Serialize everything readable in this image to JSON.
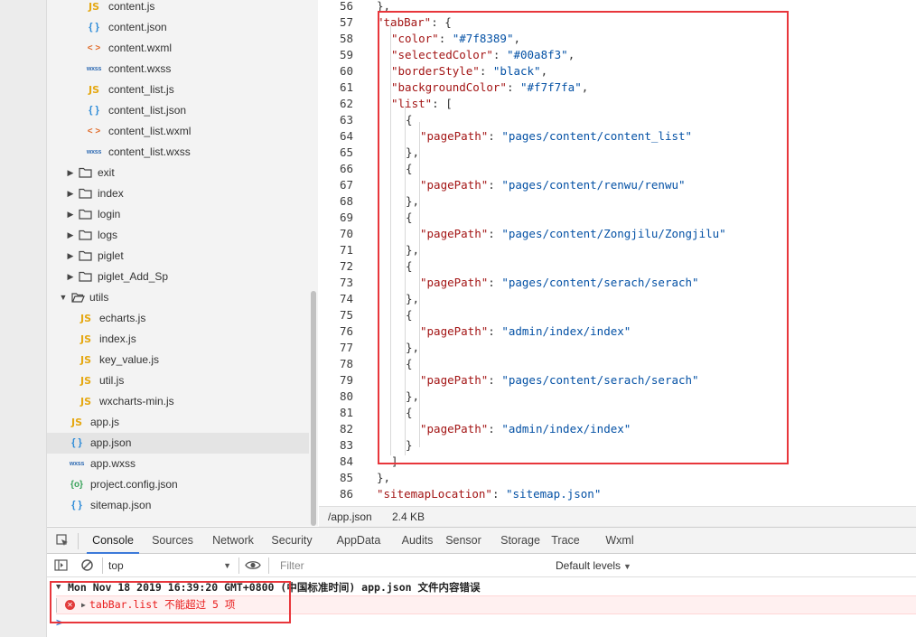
{
  "file_tree": {
    "items": [
      {
        "kind": "js",
        "icon": "JS",
        "label": "content.js"
      },
      {
        "kind": "json",
        "icon": "{ }",
        "label": "content.json"
      },
      {
        "kind": "wxml",
        "icon": "< >",
        "label": "content.wxml"
      },
      {
        "kind": "wxss",
        "icon": "wxss",
        "label": "content.wxss"
      },
      {
        "kind": "js",
        "icon": "JS",
        "label": "content_list.js"
      },
      {
        "kind": "json",
        "icon": "{ }",
        "label": "content_list.json"
      },
      {
        "kind": "wxml",
        "icon": "< >",
        "label": "content_list.wxml"
      },
      {
        "kind": "wxss",
        "icon": "wxss",
        "label": "content_list.wxss"
      },
      {
        "kind": "folder",
        "icon": "folder",
        "label": "exit"
      },
      {
        "kind": "folder",
        "icon": "folder",
        "label": "index"
      },
      {
        "kind": "folder",
        "icon": "folder",
        "label": "login"
      },
      {
        "kind": "folder",
        "icon": "folder",
        "label": "logs"
      },
      {
        "kind": "folder",
        "icon": "folder",
        "label": "piglet"
      },
      {
        "kind": "folder",
        "icon": "folder",
        "label": "piglet_Add_Sp"
      },
      {
        "kind": "folder-open",
        "icon": "folder-open",
        "label": "utils"
      },
      {
        "kind": "js",
        "icon": "JS",
        "label": "echarts.js"
      },
      {
        "kind": "js",
        "icon": "JS",
        "label": "index.js"
      },
      {
        "kind": "js",
        "icon": "JS",
        "label": "key_value.js"
      },
      {
        "kind": "js",
        "icon": "JS",
        "label": "util.js"
      },
      {
        "kind": "js",
        "icon": "JS",
        "label": "wxcharts-min.js"
      },
      {
        "kind": "js",
        "icon": "JS",
        "label": "app.js"
      },
      {
        "kind": "json",
        "icon": "{ }",
        "label": "app.json",
        "selected": true
      },
      {
        "kind": "wxss",
        "icon": "wxss",
        "label": "app.wxss"
      },
      {
        "kind": "config",
        "icon": "{o}",
        "label": "project.config.json"
      },
      {
        "kind": "json",
        "icon": "{ }",
        "label": "sitemap.json"
      }
    ]
  },
  "editor": {
    "lines": [
      {
        "n": "56",
        "t": [
          [
            "p",
            "},"
          ]
        ]
      },
      {
        "n": "57",
        "t": [
          [
            "k",
            "\"tabBar\""
          ],
          [
            "p",
            ": {"
          ]
        ]
      },
      {
        "n": "58",
        "t": [
          [
            "k",
            "\"color\""
          ],
          [
            "p",
            ": "
          ],
          [
            "s",
            "\"#7f8389\""
          ],
          [
            "p",
            ","
          ]
        ]
      },
      {
        "n": "59",
        "t": [
          [
            "k",
            "\"selectedColor\""
          ],
          [
            "p",
            ": "
          ],
          [
            "s",
            "\"#00a8f3\""
          ],
          [
            "p",
            ","
          ]
        ]
      },
      {
        "n": "60",
        "t": [
          [
            "k",
            "\"borderStyle\""
          ],
          [
            "p",
            ": "
          ],
          [
            "s",
            "\"black\""
          ],
          [
            "p",
            ","
          ]
        ]
      },
      {
        "n": "61",
        "t": [
          [
            "k",
            "\"backgroundColor\""
          ],
          [
            "p",
            ": "
          ],
          [
            "s",
            "\"#f7f7fa\""
          ],
          [
            "p",
            ","
          ]
        ]
      },
      {
        "n": "62",
        "t": [
          [
            "k",
            "\"list\""
          ],
          [
            "p",
            ": ["
          ]
        ]
      },
      {
        "n": "63",
        "t": [
          [
            "p",
            "{"
          ]
        ]
      },
      {
        "n": "64",
        "t": [
          [
            "k",
            "\"pagePath\""
          ],
          [
            "p",
            ": "
          ],
          [
            "s",
            "\"pages/content/content_list\""
          ]
        ]
      },
      {
        "n": "65",
        "t": [
          [
            "p",
            "},"
          ]
        ]
      },
      {
        "n": "66",
        "t": [
          [
            "p",
            "{"
          ]
        ]
      },
      {
        "n": "67",
        "t": [
          [
            "k",
            "\"pagePath\""
          ],
          [
            "p",
            ": "
          ],
          [
            "s",
            "\"pages/content/renwu/renwu\""
          ]
        ]
      },
      {
        "n": "68",
        "t": [
          [
            "p",
            "},"
          ]
        ]
      },
      {
        "n": "69",
        "t": [
          [
            "p",
            "{"
          ]
        ]
      },
      {
        "n": "70",
        "t": [
          [
            "k",
            "\"pagePath\""
          ],
          [
            "p",
            ": "
          ],
          [
            "s",
            "\"pages/content/Zongjilu/Zongjilu\""
          ]
        ]
      },
      {
        "n": "71",
        "t": [
          [
            "p",
            "},"
          ]
        ]
      },
      {
        "n": "72",
        "t": [
          [
            "p",
            "{"
          ]
        ]
      },
      {
        "n": "73",
        "t": [
          [
            "k",
            "\"pagePath\""
          ],
          [
            "p",
            ": "
          ],
          [
            "s",
            "\"pages/content/serach/serach\""
          ]
        ]
      },
      {
        "n": "74",
        "t": [
          [
            "p",
            "},"
          ]
        ]
      },
      {
        "n": "75",
        "t": [
          [
            "p",
            "{"
          ]
        ]
      },
      {
        "n": "76",
        "t": [
          [
            "k",
            "\"pagePath\""
          ],
          [
            "p",
            ": "
          ],
          [
            "s",
            "\"admin/index/index\""
          ]
        ]
      },
      {
        "n": "77",
        "t": [
          [
            "p",
            "},"
          ]
        ]
      },
      {
        "n": "78",
        "t": [
          [
            "p",
            "{"
          ]
        ]
      },
      {
        "n": "79",
        "t": [
          [
            "k",
            "\"pagePath\""
          ],
          [
            "p",
            ": "
          ],
          [
            "s",
            "\"pages/content/serach/serach\""
          ]
        ]
      },
      {
        "n": "80",
        "t": [
          [
            "p",
            "},"
          ]
        ]
      },
      {
        "n": "81",
        "t": [
          [
            "p",
            "{"
          ]
        ]
      },
      {
        "n": "82",
        "t": [
          [
            "k",
            "\"pagePath\""
          ],
          [
            "p",
            ": "
          ],
          [
            "s",
            "\"admin/index/index\""
          ]
        ]
      },
      {
        "n": "83",
        "t": [
          [
            "p",
            "}"
          ]
        ]
      },
      {
        "n": "84",
        "t": [
          [
            "p",
            "]"
          ]
        ]
      },
      {
        "n": "85",
        "t": [
          [
            "p",
            "},"
          ]
        ]
      },
      {
        "n": "86",
        "t": [
          [
            "k",
            "\"sitemapLocation\""
          ],
          [
            "p",
            ": "
          ],
          [
            "s",
            "\"sitemap.json\""
          ]
        ]
      }
    ]
  },
  "status_bar": {
    "path": "/app.json",
    "size": "2.4 KB"
  },
  "devtools": {
    "tabs": [
      "Console",
      "Sources",
      "Network",
      "Security",
      "AppData",
      "Audits",
      "Sensor",
      "Storage",
      "Trace",
      "Wxml"
    ],
    "active_tab": "Console"
  },
  "console_toolbar": {
    "context": "top",
    "filter_placeholder": "Filter",
    "levels": "Default levels"
  },
  "console": {
    "group_header": "Mon Nov 18 2019 16:39:20 GMT+0800 (中国标准时间)  app.json 文件内容错误",
    "error_message": "tabBar.list 不能超过 5 项",
    "prompt": ">"
  },
  "colors": {
    "highlight": "#e8363b",
    "error_text": "#e81c1c",
    "json_key": "#a31515",
    "json_string": "#0451a5",
    "active_tab_underline": "#3c7ad9"
  }
}
